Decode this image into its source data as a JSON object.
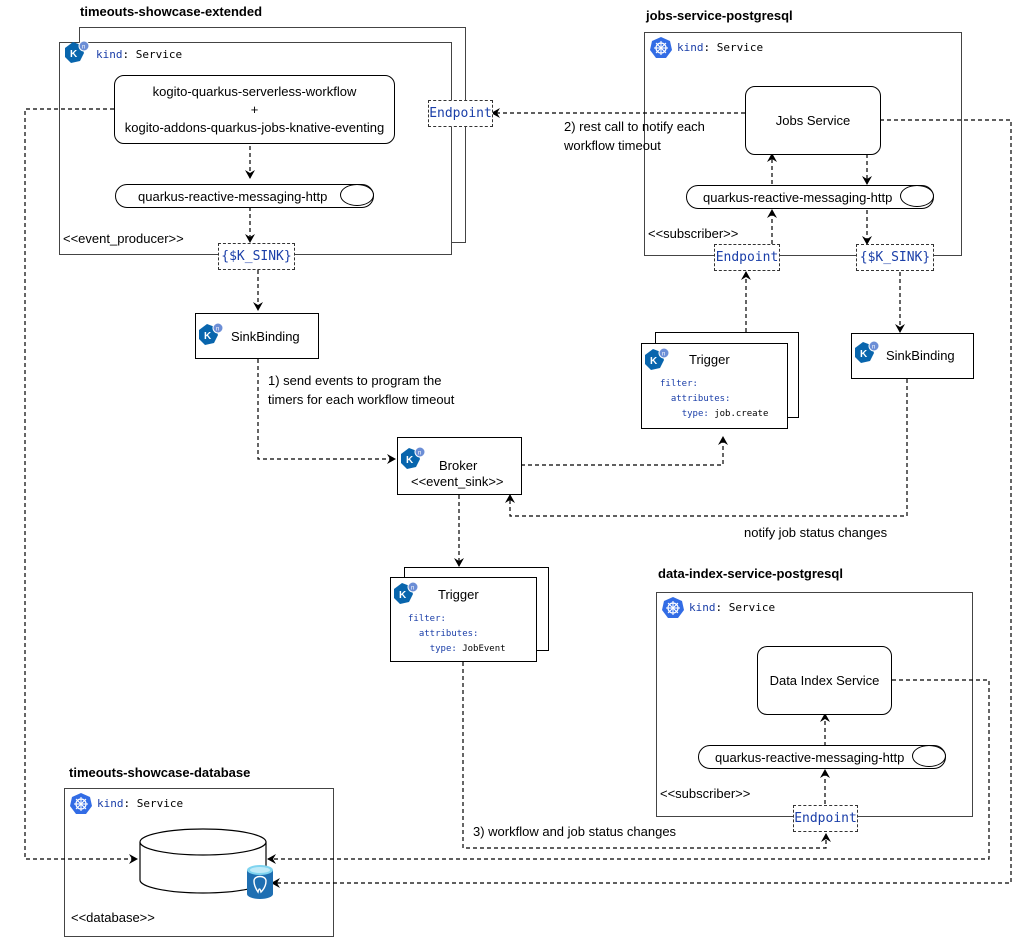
{
  "colors": {
    "knative_blue": "#0865ad",
    "kubernetes_blue": "#326ce5",
    "code_blue": "#1a3ea8",
    "postgres_blue": "#1f6fb2"
  },
  "icons": {
    "knative": "knative-icon",
    "kubernetes": "kubernetes-icon",
    "postgres": "postgresql-icon",
    "database": "database-cylinder"
  },
  "kind_label": {
    "key": "kind",
    "sep": ": ",
    "value": "Service"
  },
  "timeouts_showcase": {
    "title": "timeouts-showcase-extended",
    "app_box": {
      "line1": "kogito-quarkus-serverless-workflow",
      "line2": "+",
      "line3": "kogito-addons-quarkus-jobs-knative-eventing"
    },
    "messaging": "quarkus-reactive-messaging-http",
    "stereotype": "<<event_producer>>",
    "sink_port": "{$K_SINK}",
    "endpoint_port": "Endpoint"
  },
  "jobs_service": {
    "title": "jobs-service-postgresql",
    "app_box": "Jobs Service",
    "messaging": "quarkus-reactive-messaging-http",
    "stereotype": "<<subscriber>>",
    "endpoint_port": "Endpoint",
    "sink_port": "{$K_SINK}"
  },
  "sinkbinding_left": {
    "label": "SinkBinding"
  },
  "sinkbinding_right": {
    "label": "SinkBinding"
  },
  "broker": {
    "label": "Broker",
    "stereotype": "<<event_sink>>"
  },
  "trigger_jobs": {
    "label": "Trigger",
    "filter_key": "filter:",
    "attributes_key": "attributes:",
    "type_key": "type:",
    "type_value": "job.create"
  },
  "trigger_data_index": {
    "label": "Trigger",
    "filter_key": "filter:",
    "attributes_key": "attributes:",
    "type_key": "type:",
    "type_value": "JobEvent"
  },
  "data_index": {
    "title": "data-index-service-postgresql",
    "app_box": "Data Index Service",
    "messaging": "quarkus-reactive-messaging-http",
    "stereotype": "<<subscriber>>",
    "endpoint_port": "Endpoint"
  },
  "database": {
    "title": "timeouts-showcase-database",
    "stereotype": "<<database>>"
  },
  "notes": {
    "step1_line1": "1) send events to program the",
    "step1_line2": "timers for each workflow timeout",
    "step2_line1": "2) rest call to notify each",
    "step2_line2": "workflow timeout",
    "step3": "3) workflow and job status changes",
    "notify_job": "notify job status changes"
  }
}
